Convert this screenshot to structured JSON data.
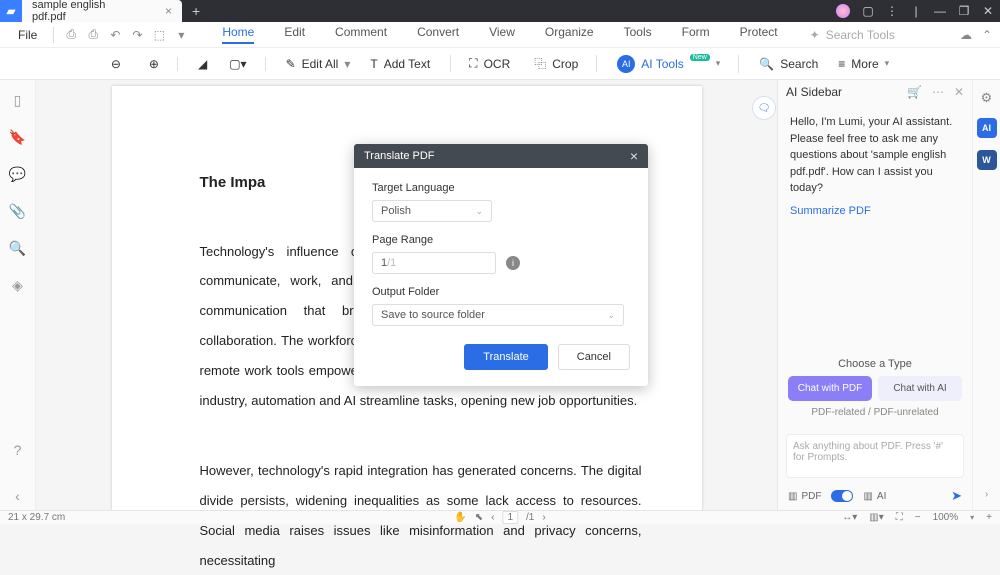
{
  "titlebar": {
    "tab_label": "sample english pdf.pdf"
  },
  "menubar": {
    "file": "File",
    "tabs": [
      "Home",
      "Edit",
      "Comment",
      "Convert",
      "View",
      "Organize",
      "Tools",
      "Form",
      "Protect"
    ],
    "active_tab": "Home",
    "search_placeholder": "Search Tools"
  },
  "toolbar": {
    "edit_all": "Edit All",
    "add_text": "Add Text",
    "ocr": "OCR",
    "crop": "Crop",
    "ai_tools": "AI Tools",
    "search": "Search",
    "more": "More"
  },
  "document": {
    "title_visible": "The Impa",
    "para1": "Technology's influence on society is profound, reshaping how we communicate, work, and learn. Connectivity has soared, with instant communication that bridges geographical gaps, enabling global collaboration. The workforce has transformed, with e-learning platforms and remote work tools empowering remote learning and flexible employment. In industry, automation and AI streamline tasks, opening new job opportunities.",
    "para2": "However, technology's rapid integration has generated concerns. The digital divide persists, widening inequalities as some lack access to resources. Social media raises issues like misinformation and privacy concerns, necessitating"
  },
  "dialog": {
    "title": "Translate PDF",
    "target_language_label": "Target Language",
    "target_language_value": "Polish",
    "page_range_label": "Page Range",
    "page_range_value": "1",
    "page_range_total": "/1",
    "output_folder_label": "Output Folder",
    "output_folder_value": "Save to source folder",
    "translate_btn": "Translate",
    "cancel_btn": "Cancel"
  },
  "sidebar": {
    "title": "AI Sidebar",
    "message": "Hello, I'm Lumi, your AI assistant. Please feel free to ask me any questions about 'sample english pdf.pdf'. How can I assist you today?",
    "summarize": "Summarize PDF",
    "choose_type": "Choose a Type",
    "chat_pdf": "Chat with PDF",
    "chat_ai": "Chat with AI",
    "related_note": "PDF-related / PDF-unrelated",
    "ask_placeholder": "Ask anything about PDF. Press '#' for Prompts.",
    "mode_pdf": "PDF",
    "mode_ai": "AI"
  },
  "statusbar": {
    "dims": "21 x 29.7 cm",
    "page_current": "1",
    "page_total": "/1",
    "zoom": "100%"
  }
}
